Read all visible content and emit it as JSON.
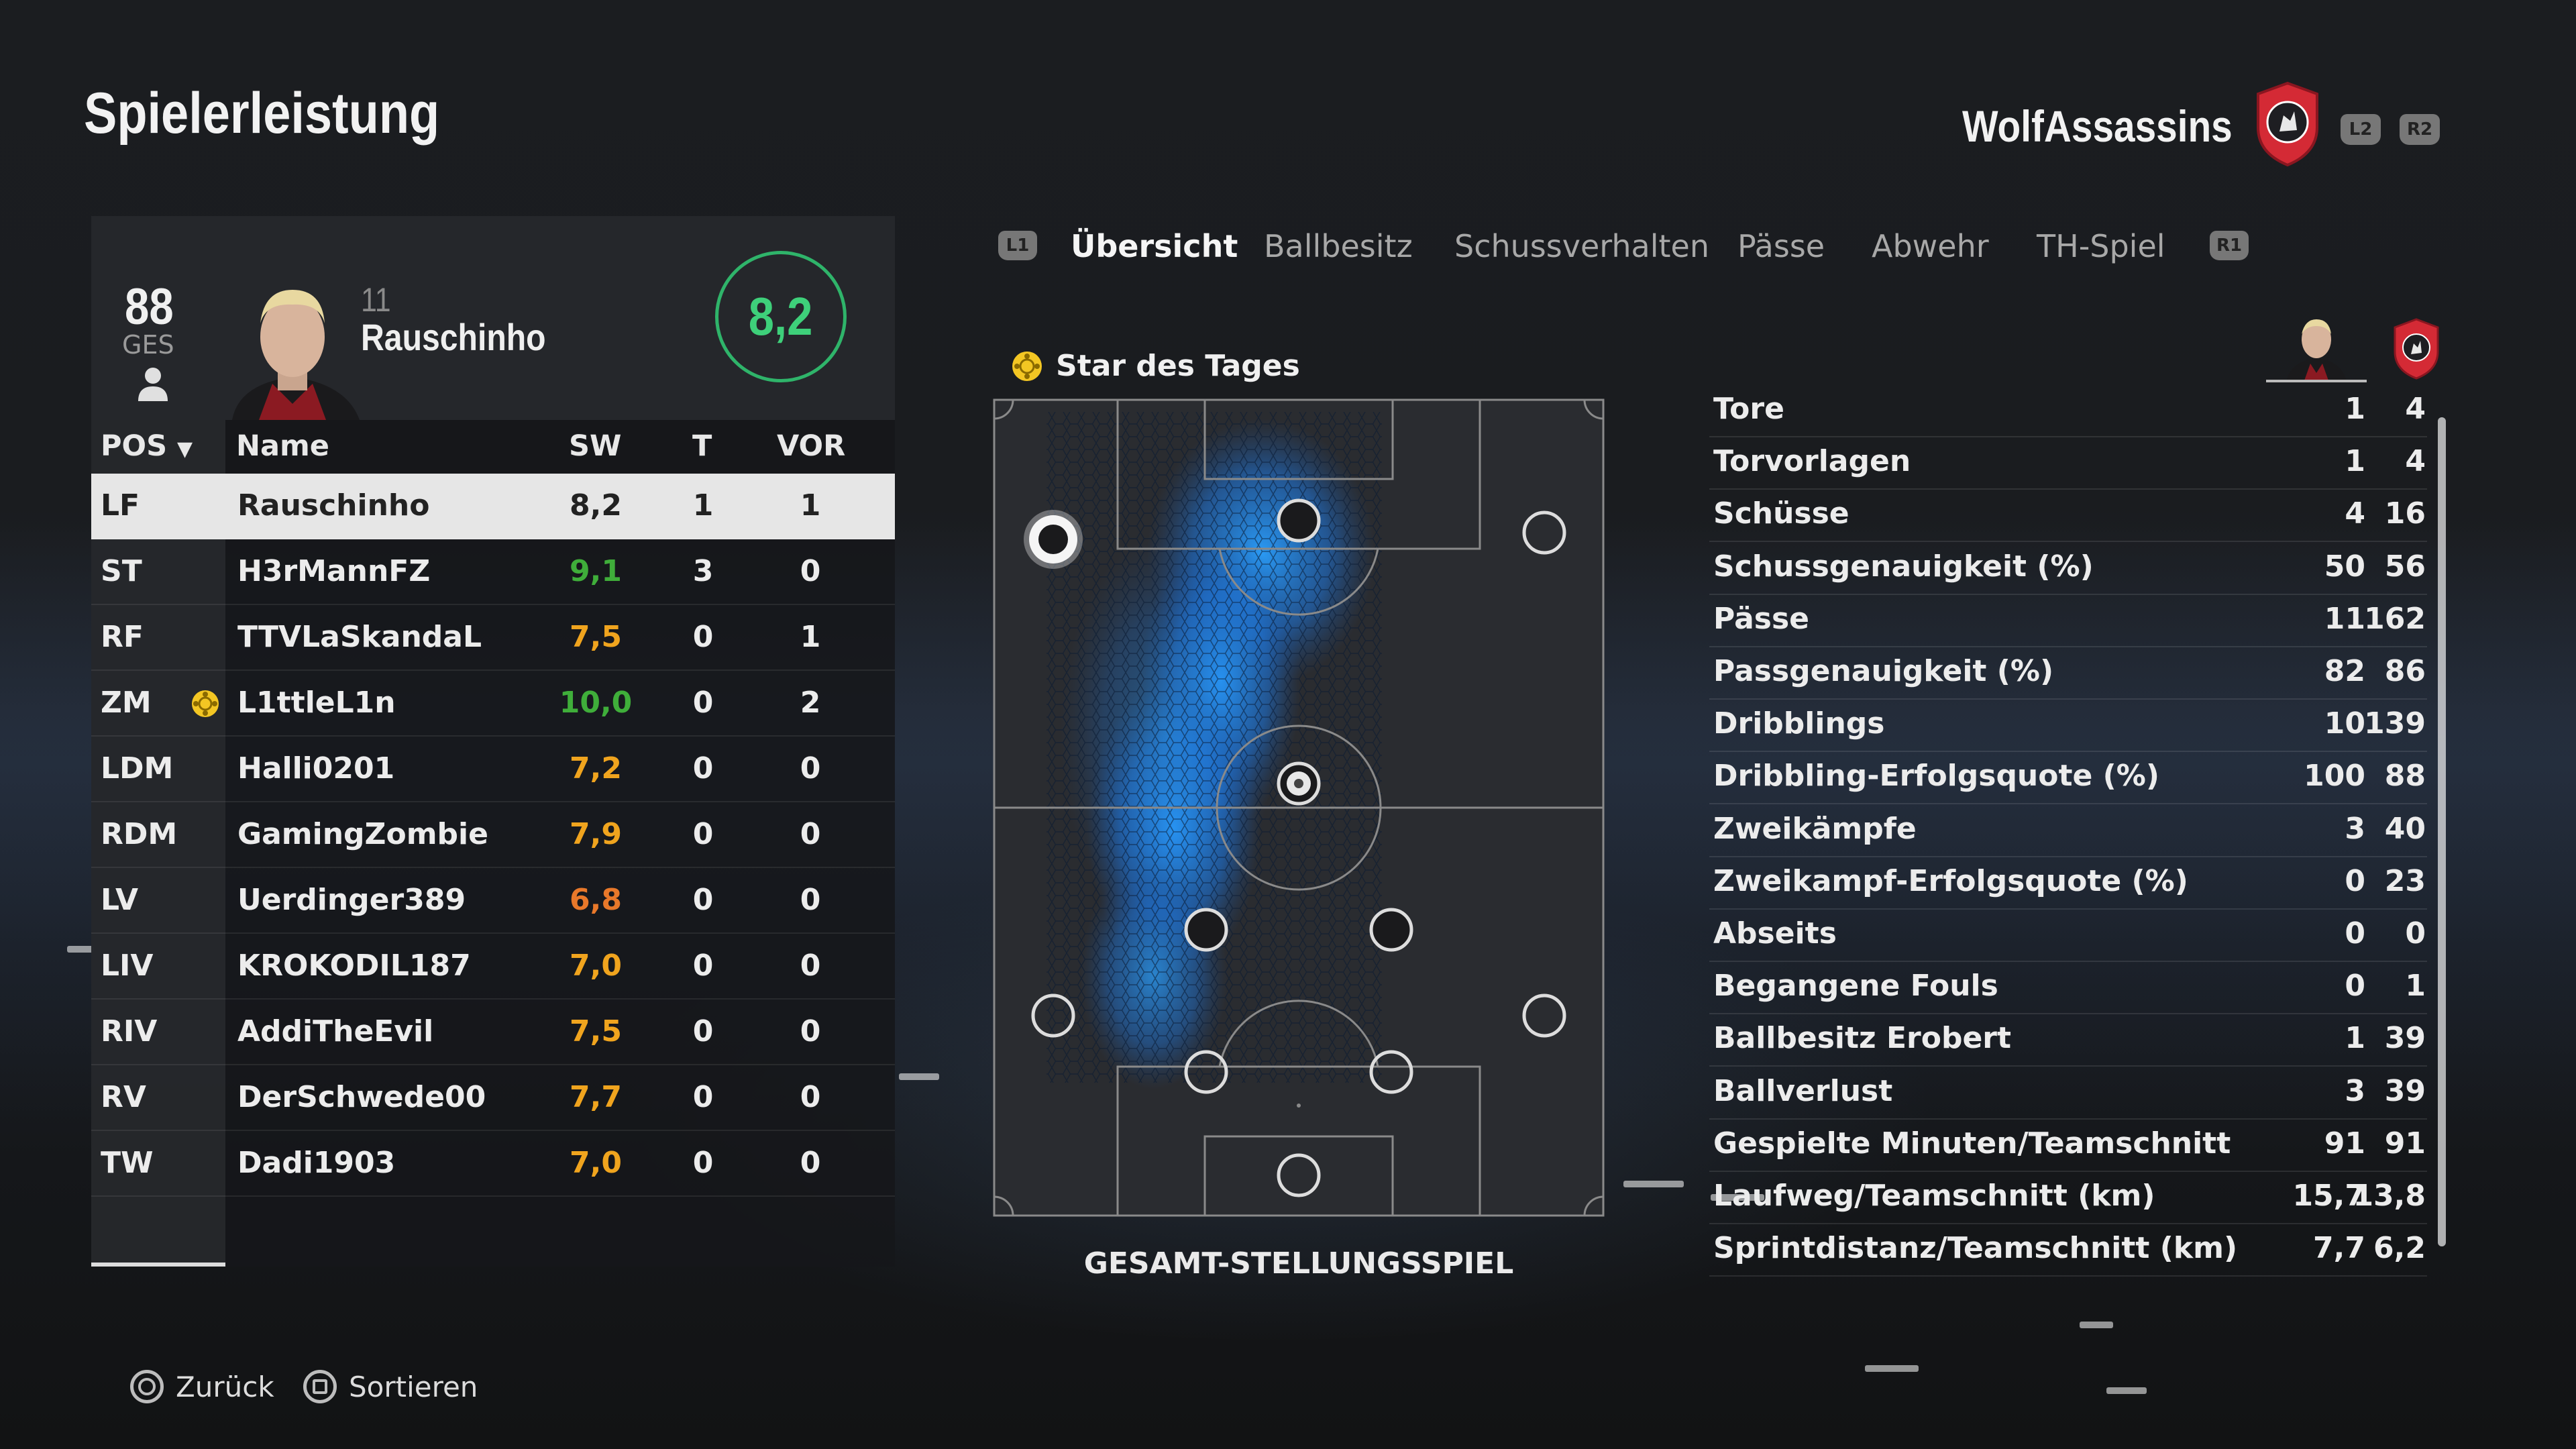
{
  "header": {
    "title": "Spielerleistung",
    "team_name": "WolfAssassins",
    "btn_l2": "L2",
    "btn_r2": "R2"
  },
  "player": {
    "overall": "88",
    "overall_label": "GES",
    "number": "11",
    "name": "Rauschinho",
    "rating": "8,2"
  },
  "table": {
    "headers": {
      "pos": "POS",
      "name": "Name",
      "sw": "SW",
      "t": "T",
      "vor": "VOR"
    },
    "rows": [
      {
        "pos": "LF",
        "name": "Rauschinho",
        "sw": "8,2",
        "t": "1",
        "vor": "1",
        "rating_color": "#222222",
        "star": false
      },
      {
        "pos": "ST",
        "name": "H3rMannFZ",
        "sw": "9,1",
        "t": "3",
        "vor": "0",
        "rating_color": "#3fae3a",
        "star": false
      },
      {
        "pos": "RF",
        "name": "TTVLaSkandaL",
        "sw": "7,5",
        "t": "0",
        "vor": "1",
        "rating_color": "#f0a41e",
        "star": false
      },
      {
        "pos": "ZM",
        "name": "L1ttleL1n",
        "sw": "10,0",
        "t": "0",
        "vor": "2",
        "rating_color": "#3fae3a",
        "star": true
      },
      {
        "pos": "LDM",
        "name": "Halli0201",
        "sw": "7,2",
        "t": "0",
        "vor": "0",
        "rating_color": "#f0a41e",
        "star": false
      },
      {
        "pos": "RDM",
        "name": "GamingZombie",
        "sw": "7,9",
        "t": "0",
        "vor": "0",
        "rating_color": "#f0a41e",
        "star": false
      },
      {
        "pos": "LV",
        "name": "Uerdinger389",
        "sw": "6,8",
        "t": "0",
        "vor": "0",
        "rating_color": "#e8782a",
        "star": false
      },
      {
        "pos": "LIV",
        "name": "KROKODIL187",
        "sw": "7,0",
        "t": "0",
        "vor": "0",
        "rating_color": "#f0a41e",
        "star": false
      },
      {
        "pos": "RIV",
        "name": "AddiTheEvil",
        "sw": "7,5",
        "t": "0",
        "vor": "0",
        "rating_color": "#f0a41e",
        "star": false
      },
      {
        "pos": "RV",
        "name": "DerSchwede00",
        "sw": "7,7",
        "t": "0",
        "vor": "0",
        "rating_color": "#f0a41e",
        "star": false
      },
      {
        "pos": "TW",
        "name": "Dadi1903",
        "sw": "7,0",
        "t": "0",
        "vor": "0",
        "rating_color": "#f0a41e",
        "star": false
      }
    ]
  },
  "tabs": {
    "l1": "L1",
    "r1": "R1",
    "items": [
      "Übersicht",
      "Ballbesitz",
      "Schussverhalten",
      "Pässe",
      "Abwehr",
      "TH-Spiel"
    ],
    "active": "Übersicht"
  },
  "pitch": {
    "star_of_day": "Star des Tages",
    "label": "GESAMT-STELLUNGSSPIEL"
  },
  "stats": [
    {
      "label": "Tore",
      "player": "1",
      "team": "4"
    },
    {
      "label": "Torvorlagen",
      "player": "1",
      "team": "4"
    },
    {
      "label": "Schüsse",
      "player": "4",
      "team": "16"
    },
    {
      "label": "Schussgenauigkeit (%)",
      "player": "50",
      "team": "56"
    },
    {
      "label": "Pässe",
      "player": "11",
      "team": "162"
    },
    {
      "label": "Passgenauigkeit (%)",
      "player": "82",
      "team": "86"
    },
    {
      "label": "Dribblings",
      "player": "10",
      "team": "139"
    },
    {
      "label": "Dribbling-Erfolgsquote (%)",
      "player": "100",
      "team": "88"
    },
    {
      "label": "Zweikämpfe",
      "player": "3",
      "team": "40"
    },
    {
      "label": "Zweikampf-Erfolgsquote (%)",
      "player": "0",
      "team": "23"
    },
    {
      "label": "Abseits",
      "player": "0",
      "team": "0"
    },
    {
      "label": "Begangene Fouls",
      "player": "0",
      "team": "1"
    },
    {
      "label": "Ballbesitz Erobert",
      "player": "1",
      "team": "39"
    },
    {
      "label": "Ballverlust",
      "player": "3",
      "team": "39"
    },
    {
      "label": "Gespielte Minuten/Teamschnitt",
      "player": "91",
      "team": "91"
    },
    {
      "label": "Laufweg/Teamschnitt (km)",
      "player": "15,7",
      "team": "13,8"
    },
    {
      "label": "Sprintdistanz/Teamschnitt (km)",
      "player": "7,7",
      "team": "6,2"
    }
  ],
  "footer": {
    "back": "Zurück",
    "sort": "Sortieren"
  },
  "colors": {
    "accent_green": "#3ed07a",
    "heatmap_blue": "#1e90ff",
    "crest_red": "#d42a35"
  }
}
